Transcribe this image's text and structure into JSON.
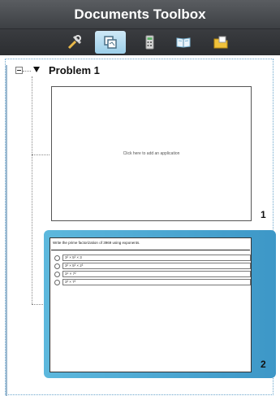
{
  "window": {
    "title": "Documents Toolbox"
  },
  "toolbar": {
    "buttons": [
      {
        "icon": "tools-icon",
        "active": false
      },
      {
        "icon": "page-sorter-icon",
        "active": true
      },
      {
        "icon": "calculator-icon",
        "active": false
      },
      {
        "icon": "book-icon",
        "active": false
      },
      {
        "icon": "folder-icon",
        "active": false
      }
    ],
    "active_color": "#9ccfe9"
  },
  "tree": {
    "problem_label": "Problem 1",
    "pages": [
      {
        "number": "1",
        "placeholder": "Click here to add an application",
        "selected": false
      },
      {
        "number": "2",
        "selected": true,
        "question": "Write the prime factorization of 3969 using exponents.",
        "choices": [
          "3² × 5³ × 3",
          "3² × 5³ × 2³",
          "3⁴ × 7²",
          "3³ × 7²"
        ]
      }
    ]
  },
  "colors": {
    "selection": "#3d97c7",
    "title_bar": "#4a4d51"
  }
}
